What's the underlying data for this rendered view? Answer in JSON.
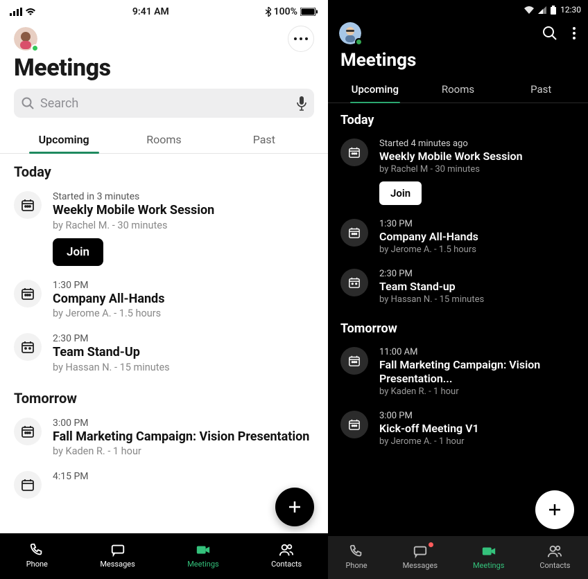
{
  "light": {
    "status": {
      "time": "9:41 AM",
      "battery": "100%"
    },
    "title": "Meetings",
    "search_placeholder": "Search",
    "tabs": {
      "upcoming": "Upcoming",
      "rooms": "Rooms",
      "past": "Past"
    },
    "section_today": "Today",
    "section_tomorrow": "Tomorrow",
    "meeting1": {
      "time": "Started in 3 minutes",
      "title": "Weekly Mobile Work Session",
      "sub": "by Rachel M. - 30 minutes",
      "join": "Join"
    },
    "meeting2": {
      "time": "1:30 PM",
      "title": "Company All-Hands",
      "sub": "by Jerome A. - 1.5 hours"
    },
    "meeting3": {
      "time": "2:30 PM",
      "title": "Team Stand-Up",
      "sub": "by Hassan N. - 15 minutes"
    },
    "meeting4": {
      "time": "3:00 PM",
      "title": "Fall Marketing Campaign: Vision Presentation",
      "sub": "by Kaden R. - 1 hour"
    },
    "meeting5": {
      "time": "4:15 PM"
    },
    "nav": {
      "phone": "Phone",
      "messages": "Messages",
      "meetings": "Meetings",
      "contacts": "Contacts"
    }
  },
  "dark": {
    "status": {
      "time": "12:30"
    },
    "title": "Meetings",
    "tabs": {
      "upcoming": "Upcoming",
      "rooms": "Rooms",
      "past": "Past"
    },
    "section_today": "Today",
    "section_tomorrow": "Tomorrow",
    "meeting1": {
      "time": "Started 4 minutes ago",
      "title": "Weekly Mobile Work Session",
      "sub": "by Rachel M - 30 minutes",
      "join": "Join"
    },
    "meeting2": {
      "time": "1:30 PM",
      "title": "Company All-Hands",
      "sub": "by Jerome A. - 1.5 hours"
    },
    "meeting3": {
      "time": "2:30 PM",
      "title": "Team Stand-up",
      "sub": "by Hassan N. - 15 minutes"
    },
    "meeting4": {
      "time": "11:00 AM",
      "title": "Fall Marketing Campaign: Vision Presentation...",
      "sub": "by Kaden R. - 1 hour"
    },
    "meeting5": {
      "time": "3:00 PM",
      "title": "Kick-off Meeting V1",
      "sub": "by Jerome A. - 1 hour"
    },
    "nav": {
      "phone": "Phone",
      "messages": "Messages",
      "meetings": "Meetings",
      "contacts": "Contacts"
    }
  }
}
